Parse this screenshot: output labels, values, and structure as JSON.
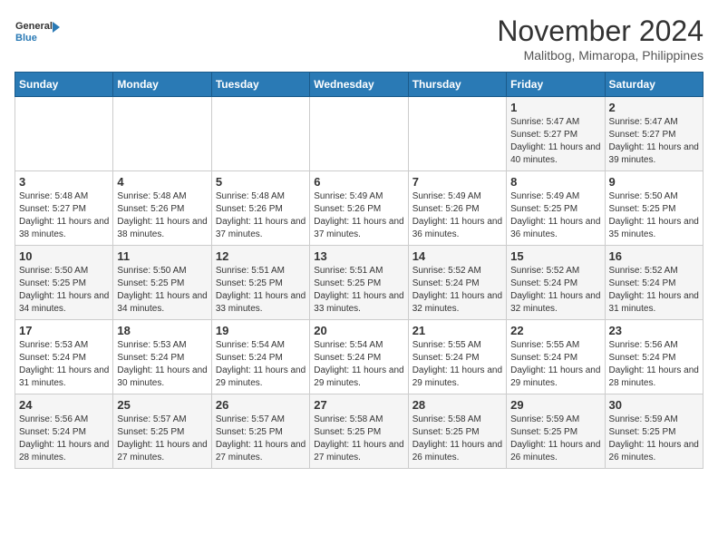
{
  "header": {
    "logo_line1": "General",
    "logo_line2": "Blue",
    "month_title": "November 2024",
    "location": "Malitbog, Mimaropa, Philippines"
  },
  "weekdays": [
    "Sunday",
    "Monday",
    "Tuesday",
    "Wednesday",
    "Thursday",
    "Friday",
    "Saturday"
  ],
  "weeks": [
    [
      {
        "day": "",
        "info": ""
      },
      {
        "day": "",
        "info": ""
      },
      {
        "day": "",
        "info": ""
      },
      {
        "day": "",
        "info": ""
      },
      {
        "day": "",
        "info": ""
      },
      {
        "day": "1",
        "info": "Sunrise: 5:47 AM\nSunset: 5:27 PM\nDaylight: 11 hours and 40 minutes."
      },
      {
        "day": "2",
        "info": "Sunrise: 5:47 AM\nSunset: 5:27 PM\nDaylight: 11 hours and 39 minutes."
      }
    ],
    [
      {
        "day": "3",
        "info": "Sunrise: 5:48 AM\nSunset: 5:27 PM\nDaylight: 11 hours and 38 minutes."
      },
      {
        "day": "4",
        "info": "Sunrise: 5:48 AM\nSunset: 5:26 PM\nDaylight: 11 hours and 38 minutes."
      },
      {
        "day": "5",
        "info": "Sunrise: 5:48 AM\nSunset: 5:26 PM\nDaylight: 11 hours and 37 minutes."
      },
      {
        "day": "6",
        "info": "Sunrise: 5:49 AM\nSunset: 5:26 PM\nDaylight: 11 hours and 37 minutes."
      },
      {
        "day": "7",
        "info": "Sunrise: 5:49 AM\nSunset: 5:26 PM\nDaylight: 11 hours and 36 minutes."
      },
      {
        "day": "8",
        "info": "Sunrise: 5:49 AM\nSunset: 5:25 PM\nDaylight: 11 hours and 36 minutes."
      },
      {
        "day": "9",
        "info": "Sunrise: 5:50 AM\nSunset: 5:25 PM\nDaylight: 11 hours and 35 minutes."
      }
    ],
    [
      {
        "day": "10",
        "info": "Sunrise: 5:50 AM\nSunset: 5:25 PM\nDaylight: 11 hours and 34 minutes."
      },
      {
        "day": "11",
        "info": "Sunrise: 5:50 AM\nSunset: 5:25 PM\nDaylight: 11 hours and 34 minutes."
      },
      {
        "day": "12",
        "info": "Sunrise: 5:51 AM\nSunset: 5:25 PM\nDaylight: 11 hours and 33 minutes."
      },
      {
        "day": "13",
        "info": "Sunrise: 5:51 AM\nSunset: 5:25 PM\nDaylight: 11 hours and 33 minutes."
      },
      {
        "day": "14",
        "info": "Sunrise: 5:52 AM\nSunset: 5:24 PM\nDaylight: 11 hours and 32 minutes."
      },
      {
        "day": "15",
        "info": "Sunrise: 5:52 AM\nSunset: 5:24 PM\nDaylight: 11 hours and 32 minutes."
      },
      {
        "day": "16",
        "info": "Sunrise: 5:52 AM\nSunset: 5:24 PM\nDaylight: 11 hours and 31 minutes."
      }
    ],
    [
      {
        "day": "17",
        "info": "Sunrise: 5:53 AM\nSunset: 5:24 PM\nDaylight: 11 hours and 31 minutes."
      },
      {
        "day": "18",
        "info": "Sunrise: 5:53 AM\nSunset: 5:24 PM\nDaylight: 11 hours and 30 minutes."
      },
      {
        "day": "19",
        "info": "Sunrise: 5:54 AM\nSunset: 5:24 PM\nDaylight: 11 hours and 29 minutes."
      },
      {
        "day": "20",
        "info": "Sunrise: 5:54 AM\nSunset: 5:24 PM\nDaylight: 11 hours and 29 minutes."
      },
      {
        "day": "21",
        "info": "Sunrise: 5:55 AM\nSunset: 5:24 PM\nDaylight: 11 hours and 29 minutes."
      },
      {
        "day": "22",
        "info": "Sunrise: 5:55 AM\nSunset: 5:24 PM\nDaylight: 11 hours and 29 minutes."
      },
      {
        "day": "23",
        "info": "Sunrise: 5:56 AM\nSunset: 5:24 PM\nDaylight: 11 hours and 28 minutes."
      }
    ],
    [
      {
        "day": "24",
        "info": "Sunrise: 5:56 AM\nSunset: 5:24 PM\nDaylight: 11 hours and 28 minutes."
      },
      {
        "day": "25",
        "info": "Sunrise: 5:57 AM\nSunset: 5:25 PM\nDaylight: 11 hours and 27 minutes."
      },
      {
        "day": "26",
        "info": "Sunrise: 5:57 AM\nSunset: 5:25 PM\nDaylight: 11 hours and 27 minutes."
      },
      {
        "day": "27",
        "info": "Sunrise: 5:58 AM\nSunset: 5:25 PM\nDaylight: 11 hours and 27 minutes."
      },
      {
        "day": "28",
        "info": "Sunrise: 5:58 AM\nSunset: 5:25 PM\nDaylight: 11 hours and 26 minutes."
      },
      {
        "day": "29",
        "info": "Sunrise: 5:59 AM\nSunset: 5:25 PM\nDaylight: 11 hours and 26 minutes."
      },
      {
        "day": "30",
        "info": "Sunrise: 5:59 AM\nSunset: 5:25 PM\nDaylight: 11 hours and 26 minutes."
      }
    ]
  ]
}
